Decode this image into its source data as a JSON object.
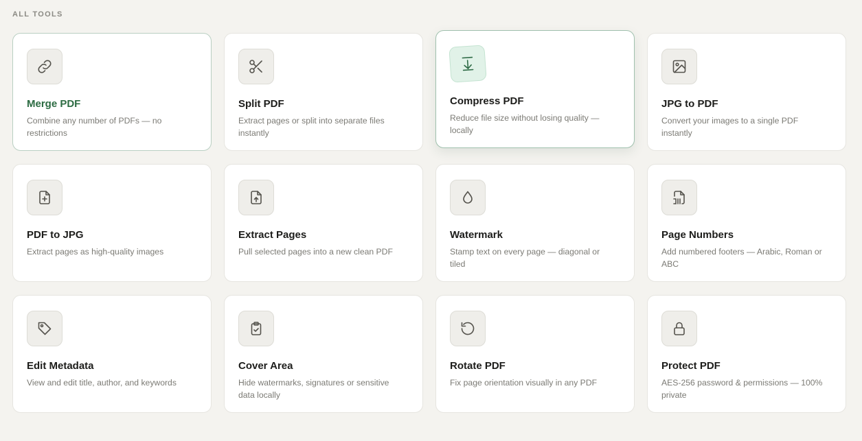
{
  "section": {
    "label": "ALL TOOLS"
  },
  "tools": [
    {
      "title": "Merge PDF",
      "desc": "Combine any number of PDFs — no restrictions",
      "icon": "link-icon"
    },
    {
      "title": "Split PDF",
      "desc": "Extract pages or split into separate files instantly",
      "icon": "scissors-icon"
    },
    {
      "title": "Compress PDF",
      "desc": "Reduce file size without losing quality — locally",
      "icon": "compress-download-icon"
    },
    {
      "title": "JPG to PDF",
      "desc": "Convert your images to a single PDF instantly",
      "icon": "image-icon"
    },
    {
      "title": "PDF to JPG",
      "desc": "Extract pages as high-quality images",
      "icon": "file-plus-icon"
    },
    {
      "title": "Extract Pages",
      "desc": "Pull selected pages into a new clean PDF",
      "icon": "file-upload-icon"
    },
    {
      "title": "Watermark",
      "desc": "Stamp text on every page — diagonal or tiled",
      "icon": "droplet-icon"
    },
    {
      "title": "Page Numbers",
      "desc": "Add numbered footers — Arabic, Roman or ABC",
      "icon": "file-numbers-icon"
    },
    {
      "title": "Edit Metadata",
      "desc": "View and edit title, author, and keywords",
      "icon": "tag-icon"
    },
    {
      "title": "Cover Area",
      "desc": "Hide watermarks, signatures or sensitive data locally",
      "icon": "clipboard-check-icon"
    },
    {
      "title": "Rotate PDF",
      "desc": "Fix page orientation visually in any PDF",
      "icon": "rotate-icon"
    },
    {
      "title": "Protect PDF",
      "desc": "AES-256 password & permissions — 100% private",
      "icon": "lock-icon"
    }
  ]
}
